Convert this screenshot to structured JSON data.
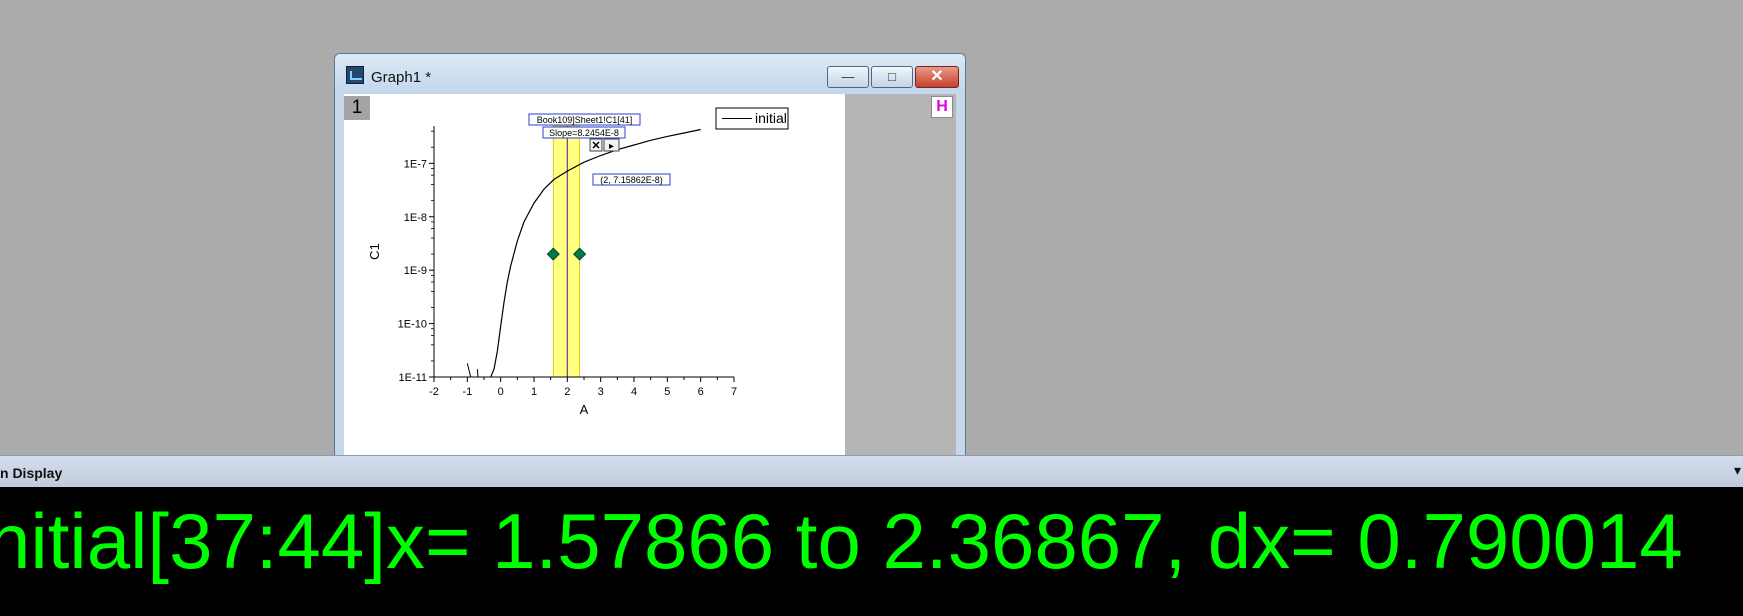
{
  "window": {
    "title": "Graph1 *",
    "layer_number": "1",
    "h_button": "H",
    "minimize_glyph": "—",
    "maximize_glyph": "□",
    "close_glyph": "✕"
  },
  "legend": {
    "label": "initial"
  },
  "annotations": {
    "source": "Book109]Sheet1!C1[41]",
    "slope": "Slope=8.2454E-8",
    "point": "(2, 7.15862E-8)",
    "close_glyph": "✕",
    "arrow_glyph": "▸"
  },
  "chart_data": {
    "type": "line",
    "xlabel": "A",
    "ylabel": "C1",
    "y_scale": "log",
    "xlim": [
      -2,
      7
    ],
    "ylim": [
      1e-11,
      5e-07
    ],
    "x_ticks": [
      "-2",
      "-1",
      "0",
      "1",
      "2",
      "3",
      "4",
      "5",
      "6",
      "7"
    ],
    "y_ticks": [
      {
        "value": 1e-07,
        "label": "1E-7"
      },
      {
        "value": 1e-08,
        "label": "1E-8"
      },
      {
        "value": 1e-09,
        "label": "1E-9"
      },
      {
        "value": 1e-10,
        "label": "1E-10"
      },
      {
        "value": 1e-11,
        "label": "1E-11"
      }
    ],
    "series": [
      {
        "name": "initial",
        "color": "#000000",
        "x": [
          -0.3,
          -0.2,
          -0.1,
          0.0,
          0.1,
          0.2,
          0.3,
          0.5,
          0.7,
          1.0,
          1.3,
          1.6,
          2.0,
          2.5,
          3.0,
          3.5,
          4.0,
          4.5,
          5.0,
          5.5,
          6.0
        ],
        "y": [
          1e-11,
          1.4e-11,
          3e-11,
          9e-11,
          2.5e-10,
          6e-10,
          1.2e-09,
          3.5e-09,
          8e-09,
          1.8e-08,
          3.3e-08,
          5e-08,
          7.16e-08,
          1.05e-07,
          1.4e-07,
          1.8e-07,
          2.2e-07,
          2.7e-07,
          3.2e-07,
          3.7e-07,
          4.3e-07
        ]
      }
    ],
    "selection": {
      "x_start": 1.57866,
      "x_end": 2.36867,
      "cursor_x": 2.0,
      "highlight_color": "#ffff80"
    },
    "marker_color": "#007a3d"
  },
  "data_display": {
    "title": "n Display",
    "collapse_glyph": "▾",
    "readout": "nitial[37:44]x= 1.57866 to 2.36867, dx= 0.790014"
  }
}
